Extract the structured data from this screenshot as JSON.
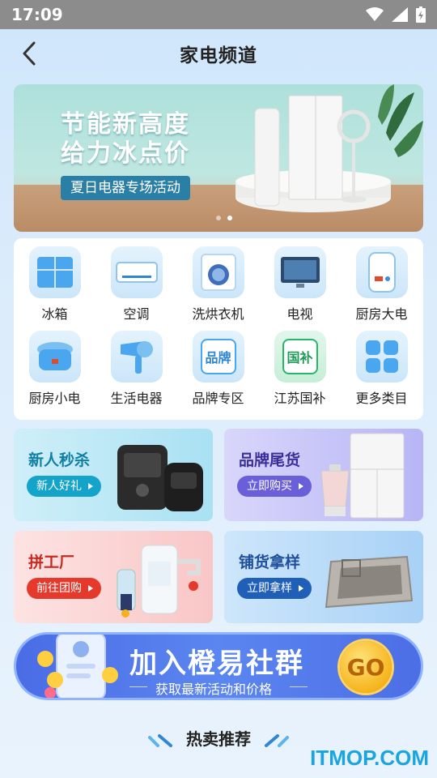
{
  "status_bar": {
    "time": "17:09"
  },
  "header": {
    "title": "家电频道"
  },
  "banner": {
    "title_line1": "节能新高度",
    "title_line2": "给力冰点价",
    "tag": "夏日电器专场活动"
  },
  "categories": [
    {
      "label": "冰箱",
      "icon": "fridge-icon"
    },
    {
      "label": "空调",
      "icon": "air-conditioner-icon"
    },
    {
      "label": "洗烘衣机",
      "icon": "washing-machine-icon"
    },
    {
      "label": "电视",
      "icon": "tv-icon"
    },
    {
      "label": "厨房大电",
      "icon": "water-heater-icon"
    },
    {
      "label": "厨房小电",
      "icon": "rice-cooker-icon"
    },
    {
      "label": "生活电器",
      "icon": "hair-dryer-icon"
    },
    {
      "label": "品牌专区",
      "icon": "brand-icon",
      "icon_text": "品牌"
    },
    {
      "label": "江苏国补",
      "icon": "subsidy-icon",
      "icon_text": "国补"
    },
    {
      "label": "更多类目",
      "icon": "grid-icon"
    }
  ],
  "promos": {
    "newcomer": {
      "title": "新人秒杀",
      "button": "新人好礼"
    },
    "brand_clearance": {
      "title": "品牌尾货",
      "button": "立即购买"
    },
    "group_buy": {
      "title": "拼工厂",
      "button": "前往团购"
    },
    "sample": {
      "title": "铺货拿样",
      "button": "立即拿样"
    }
  },
  "join": {
    "title": "加入橙易社群",
    "subtitle": "获取最新活动和价格",
    "go": "GO"
  },
  "hot": {
    "title": "热卖推荐"
  },
  "watermark": "ITMOP.COM"
}
